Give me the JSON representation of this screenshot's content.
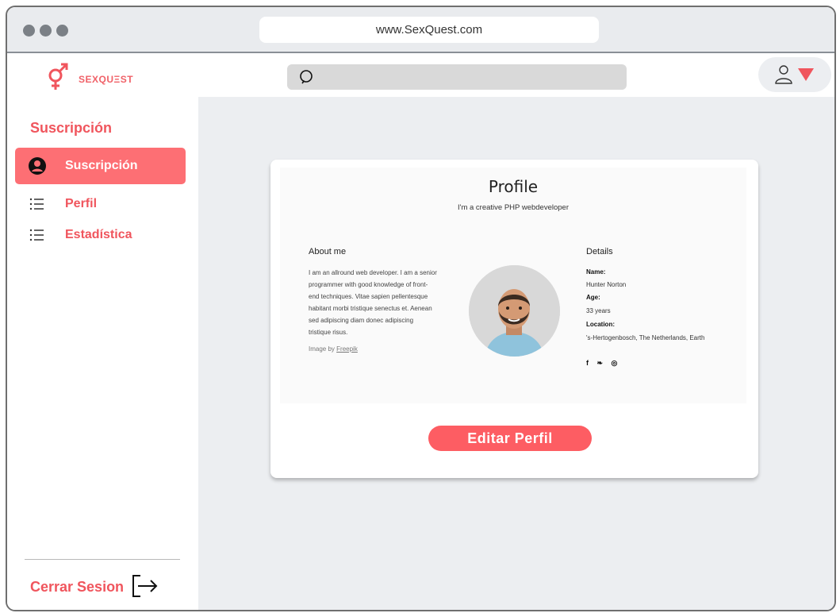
{
  "browser": {
    "url": "www.SexQuest.com"
  },
  "brand": {
    "name": "SEXQUΞST",
    "accent": "#f0555d"
  },
  "sidebar": {
    "heading": "Suscripción",
    "items": [
      {
        "label": "Suscripción",
        "icon": "user-circle-icon",
        "active": true
      },
      {
        "label": "Perfil",
        "icon": "list-icon",
        "active": false
      },
      {
        "label": "Estadística",
        "icon": "list-icon",
        "active": false
      }
    ],
    "logout_label": "Cerrar Sesion"
  },
  "topbar": {
    "search_placeholder": ""
  },
  "profile": {
    "title": "Profile",
    "subtitle": "I'm a creative PHP webdeveloper",
    "about_heading": "About me",
    "about_text": "I am an allround web developer. I am a senior programmer with good knowledge of front-end techniques. Vitae sapien pellentesque habitant morbi tristique senectus et. Aenean sed adipiscing diam donec adipiscing tristique risus.",
    "credit_prefix": "Image by",
    "credit_link": "Freepik",
    "details_heading": "Details",
    "name_label": "Name:",
    "name_value": "Hunter Norton",
    "age_label": "Age:",
    "age_value": "33 years",
    "location_label": "Location:",
    "location_value": "'s-Hertogenbosch, The Netherlands, Earth",
    "social": [
      "f",
      "❧",
      "◎"
    ]
  },
  "actions": {
    "edit_profile_label": "Editar Perfil"
  }
}
